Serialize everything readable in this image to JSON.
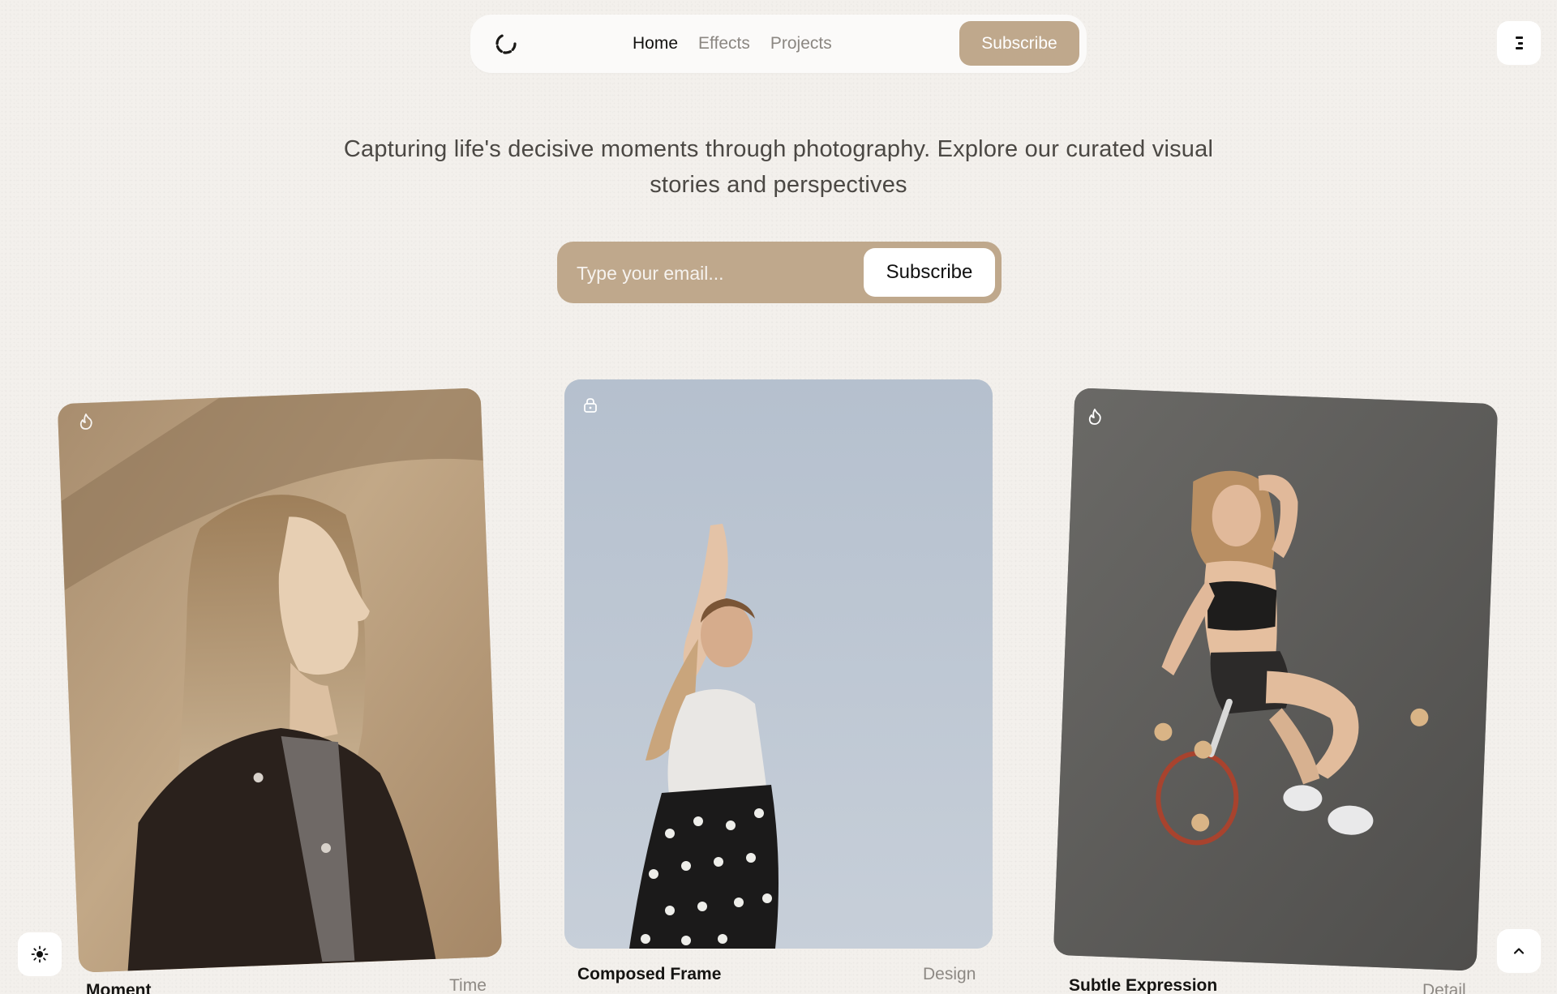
{
  "nav": {
    "logo_icon": "spinner-logo-icon",
    "links": [
      {
        "label": "Home",
        "active": true
      },
      {
        "label": "Effects",
        "active": false
      },
      {
        "label": "Projects",
        "active": false
      }
    ],
    "subscribe_label": "Subscribe",
    "menu_icon": "menu-icon"
  },
  "hero": {
    "tagline": "Capturing life's decisive moments through photography. Explore our curated visual stories and perspectives",
    "email_placeholder": "Type your email...",
    "email_value": "",
    "subscribe_label": "Subscribe"
  },
  "cards": [
    {
      "title": "Moment",
      "tag": "Time",
      "icon": "flame-icon",
      "photo": "woman in leather jacket, sepia tone"
    },
    {
      "title": "Composed Frame",
      "tag": "Design",
      "icon": "lock-icon",
      "photo": "woman reaching up against blue sky"
    },
    {
      "title": "Subtle Expression",
      "tag": "Detail",
      "icon": "flame-icon",
      "photo": "woman seated on tennis court with racket"
    }
  ],
  "controls": {
    "theme_icon": "sun-icon",
    "scroll_top_icon": "chevron-up-icon"
  },
  "colors": {
    "background": "#f3f0ec",
    "accent": "#bfa88c",
    "nav_background": "#fbfaf9",
    "muted_text": "#8b8782"
  }
}
